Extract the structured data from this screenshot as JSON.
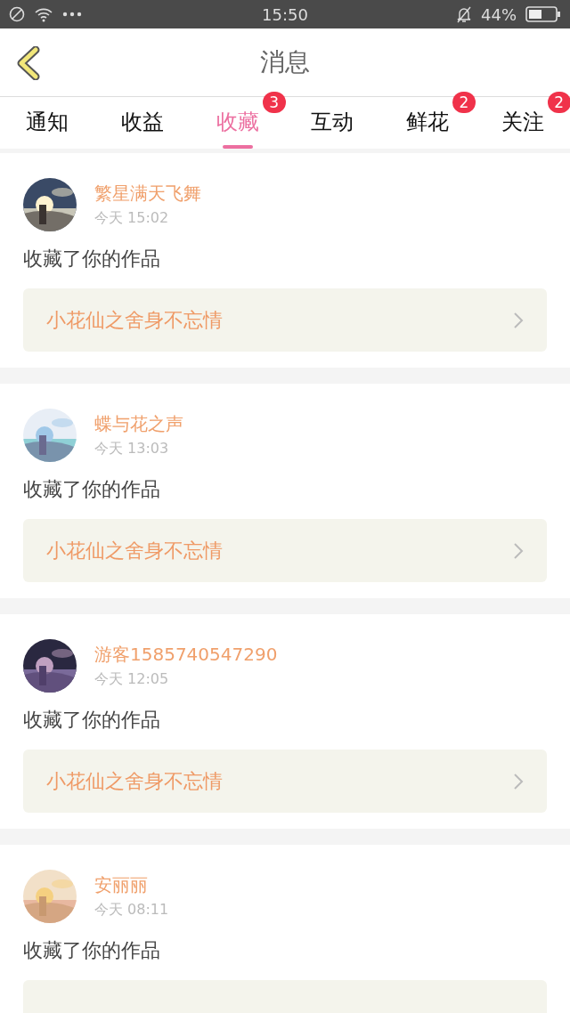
{
  "status_bar": {
    "time": "15:50",
    "battery": "44%"
  },
  "header": {
    "title": "消息"
  },
  "tabs": [
    {
      "label": "通知",
      "selected": false
    },
    {
      "label": "收益",
      "selected": false
    },
    {
      "label": "收藏",
      "selected": true,
      "badge": "3"
    },
    {
      "label": "互动",
      "selected": false
    },
    {
      "label": "鲜花",
      "selected": false,
      "badge": "2"
    },
    {
      "label": "关注",
      "selected": false,
      "badge": "2"
    }
  ],
  "messages": [
    {
      "name": "繁星满天飞舞",
      "time": "今天 15:02",
      "action": "收藏了你的作品",
      "work": "小花仙之舍身不忘情"
    },
    {
      "name": "蝶与花之声",
      "time": "今天 13:03",
      "action": "收藏了你的作品",
      "work": "小花仙之舍身不忘情"
    },
    {
      "name": "游客1585740547290",
      "time": "今天 12:05",
      "action": "收藏了你的作品",
      "work": "小花仙之舍身不忘情"
    },
    {
      "name": "安丽丽",
      "time": "今天 08:11",
      "action": "收藏了你的作品"
    }
  ]
}
